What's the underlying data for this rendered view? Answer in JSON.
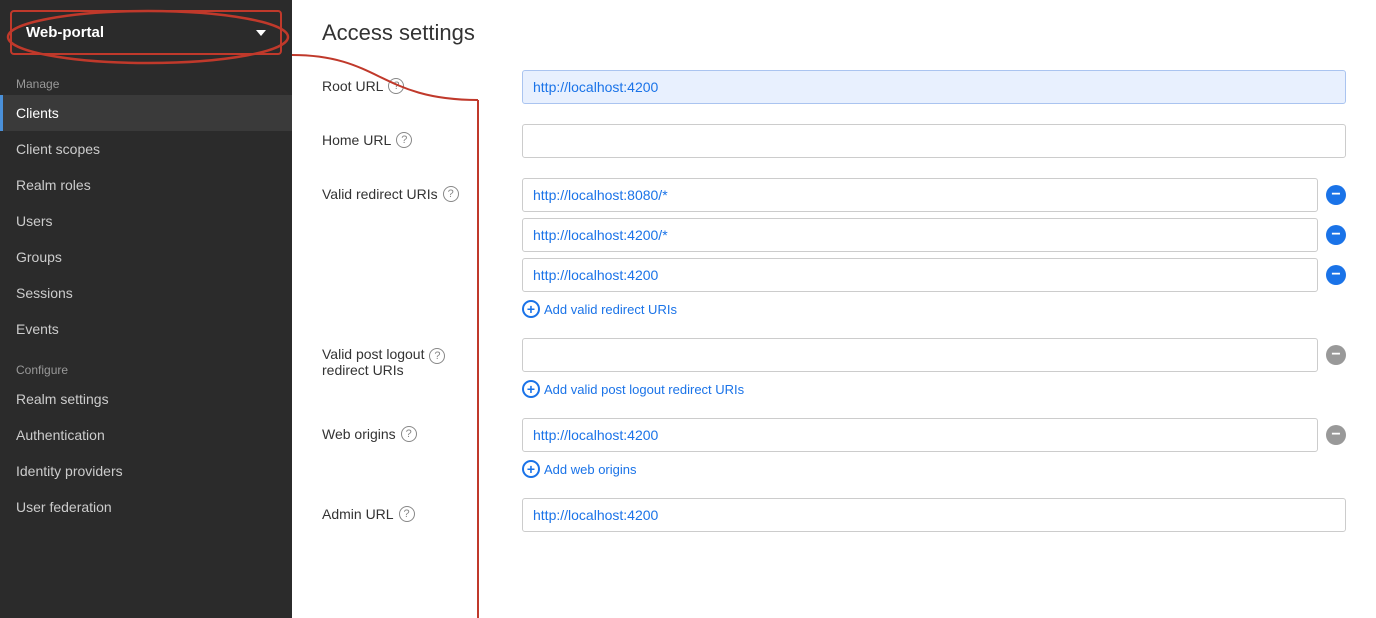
{
  "sidebar": {
    "realm": "Web-portal",
    "manage_label": "Manage",
    "items_manage": [
      {
        "id": "clients",
        "label": "Clients",
        "active": true
      },
      {
        "id": "client-scopes",
        "label": "Client scopes",
        "active": false
      },
      {
        "id": "realm-roles",
        "label": "Realm roles",
        "active": false
      },
      {
        "id": "users",
        "label": "Users",
        "active": false
      },
      {
        "id": "groups",
        "label": "Groups",
        "active": false
      },
      {
        "id": "sessions",
        "label": "Sessions",
        "active": false
      },
      {
        "id": "events",
        "label": "Events",
        "active": false
      }
    ],
    "configure_label": "Configure",
    "items_configure": [
      {
        "id": "realm-settings",
        "label": "Realm settings",
        "active": false
      },
      {
        "id": "authentication",
        "label": "Authentication",
        "active": false
      },
      {
        "id": "identity-providers",
        "label": "Identity providers",
        "active": false
      },
      {
        "id": "user-federation",
        "label": "User federation",
        "active": false
      }
    ]
  },
  "main": {
    "title": "Access settings",
    "fields": [
      {
        "id": "root-url",
        "label": "Root URL",
        "has_help": true,
        "inputs": [
          {
            "value": "http://localhost:4200",
            "highlighted": true,
            "removable": false
          }
        ],
        "add_link": null
      },
      {
        "id": "home-url",
        "label": "Home URL",
        "has_help": true,
        "inputs": [
          {
            "value": "",
            "highlighted": false,
            "removable": false
          }
        ],
        "add_link": null
      },
      {
        "id": "valid-redirect-uris",
        "label": "Valid redirect URIs",
        "has_help": true,
        "inputs": [
          {
            "value": "http://localhost:8080/*",
            "highlighted": false,
            "removable": true
          },
          {
            "value": "http://localhost:4200/*",
            "highlighted": false,
            "removable": true
          },
          {
            "value": "http://localhost:4200",
            "highlighted": false,
            "removable": true
          }
        ],
        "add_link": "Add valid redirect URIs"
      },
      {
        "id": "valid-post-logout-redirect-uris",
        "label": "Valid post logout redirect URIs",
        "has_help": true,
        "inputs": [
          {
            "value": "",
            "highlighted": false,
            "removable": true,
            "grey": true
          }
        ],
        "add_link": "Add valid post logout redirect URIs"
      },
      {
        "id": "web-origins",
        "label": "Web origins",
        "has_help": true,
        "inputs": [
          {
            "value": "http://localhost:4200",
            "highlighted": false,
            "removable": true,
            "grey": true
          }
        ],
        "add_link": "Add web origins"
      },
      {
        "id": "admin-url",
        "label": "Admin URL",
        "has_help": true,
        "inputs": [
          {
            "value": "http://localhost:4200",
            "highlighted": false,
            "removable": false
          }
        ],
        "add_link": null
      }
    ]
  }
}
